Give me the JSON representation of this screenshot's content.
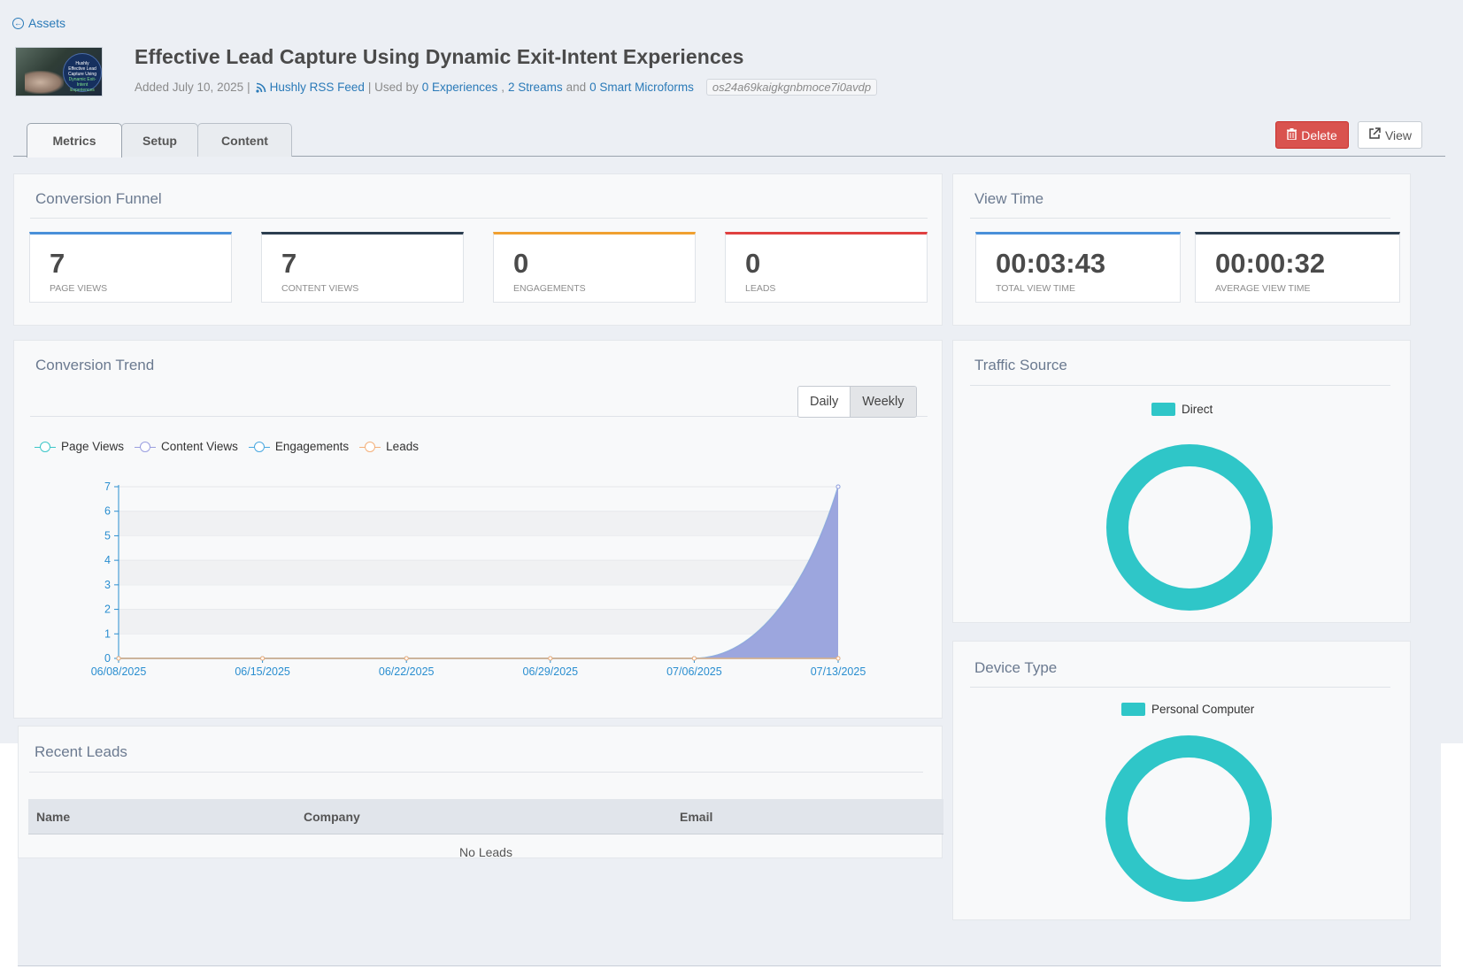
{
  "header": {
    "back_label": "Assets",
    "title": "Effective Lead Capture Using Dynamic Exit-Intent Experiences",
    "added": "Added July 10, 2025",
    "sep1": "|",
    "feed": "Hushly RSS Feed",
    "used_by": "| Used by",
    "experiences": "0 Experiences",
    "comma": ",",
    "streams": "2 Streams",
    "and": "and",
    "microforms": "0 Smart Microforms",
    "asset_id": "os24a69kaigkgnbmoce7i0avdp",
    "thumb_text_1": "Hushly",
    "thumb_text_2": "Effective Lead Capture Using",
    "thumb_text_3": "Dynamic Exit-Intent",
    "thumb_text_4": "Experiences"
  },
  "tabs": [
    {
      "label": "Metrics",
      "active": true
    },
    {
      "label": "Setup",
      "active": false
    },
    {
      "label": "Content",
      "active": false
    }
  ],
  "actions": {
    "delete_label": "Delete",
    "view_label": "View"
  },
  "funnel": {
    "title": "Conversion Funnel",
    "stats": [
      {
        "value": "7",
        "label": "PAGE VIEWS",
        "color": "#4a90d9"
      },
      {
        "value": "7",
        "label": "CONTENT VIEWS",
        "color": "#2c3e50"
      },
      {
        "value": "0",
        "label": "ENGAGEMENTS",
        "color": "#f0a030"
      },
      {
        "value": "0",
        "label": "LEADS",
        "color": "#e04040"
      }
    ]
  },
  "view_time": {
    "title": "View Time",
    "stats": [
      {
        "value": "00:03:43",
        "label": "TOTAL VIEW TIME",
        "color": "#4a90d9"
      },
      {
        "value": "00:00:32",
        "label": "AVERAGE VIEW TIME",
        "color": "#2c3e50"
      }
    ]
  },
  "trend": {
    "title": "Conversion Trend",
    "toggle": {
      "daily": "Daily",
      "weekly": "Weekly",
      "selected": "Weekly"
    }
  },
  "chart_data": {
    "type": "area",
    "title": "",
    "xlabel": "",
    "ylabel": "",
    "categories": [
      "06/08/2025",
      "06/15/2025",
      "06/22/2025",
      "06/29/2025",
      "07/06/2025",
      "07/13/2025"
    ],
    "ylim": [
      0,
      7
    ],
    "yticks": [
      "0",
      "1",
      "2",
      "3",
      "4",
      "5",
      "6",
      "7"
    ],
    "grid": true,
    "legend": "top-left",
    "series": [
      {
        "name": "Page Views",
        "values": [
          0,
          0,
          0,
          0,
          0,
          7
        ],
        "color": "#3cc6c8"
      },
      {
        "name": "Content Views",
        "values": [
          0,
          0,
          0,
          0,
          0,
          7
        ],
        "color": "#9a9fe0"
      },
      {
        "name": "Engagements",
        "values": [
          0,
          0,
          0,
          0,
          0,
          0
        ],
        "color": "#4aa8e0"
      },
      {
        "name": "Leads",
        "values": [
          0,
          0,
          0,
          0,
          0,
          0
        ],
        "color": "#f4b07a"
      }
    ]
  },
  "leads": {
    "title": "Recent Leads",
    "columns": [
      "Name",
      "Company",
      "Email"
    ],
    "empty": "No Leads"
  },
  "traffic": {
    "title": "Traffic Source",
    "legend": "Direct",
    "color": "#2fc6c8",
    "share": 1.0
  },
  "device": {
    "title": "Device Type",
    "legend": "Personal Computer",
    "color": "#2fc6c8",
    "share": 1.0
  }
}
